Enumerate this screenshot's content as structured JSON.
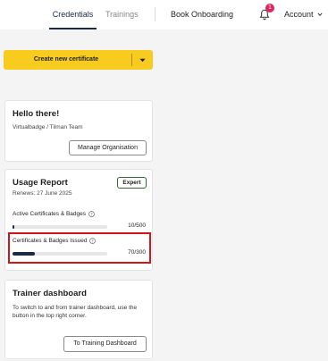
{
  "nav": {
    "tabs": [
      {
        "label": "Credentials",
        "active": true
      },
      {
        "label": "Trainings",
        "active": false
      }
    ],
    "book_onboarding": "Book Onboarding",
    "notification_count": "1",
    "account": "Account",
    "accent_color": "#1a2b4a"
  },
  "cta": {
    "label": "Create new certificate",
    "color": "#f7cc1e",
    "dropdown_icon": "caret-down-icon"
  },
  "hello_card": {
    "title": "Hello there!",
    "org": "Virtualbadge / Tilman Team",
    "button": "Manage Organisation"
  },
  "usage_card": {
    "title": "Usage Report",
    "renews": "Renews: 27 June 2025",
    "plan": "Expert",
    "metrics": [
      {
        "label": "Active Certificates & Badges",
        "value_text": "10/500",
        "used": 10,
        "limit": 500
      },
      {
        "label": "Certificates & Badges Issued",
        "value_text": "70/300",
        "used": 70,
        "limit": 300,
        "highlighted": true
      }
    ]
  },
  "trainer_card": {
    "title": "Trainer dashboard",
    "description": "To switch to and from trainer dashboard, use the button in the top right corner.",
    "button": "To Training Dashboard"
  }
}
